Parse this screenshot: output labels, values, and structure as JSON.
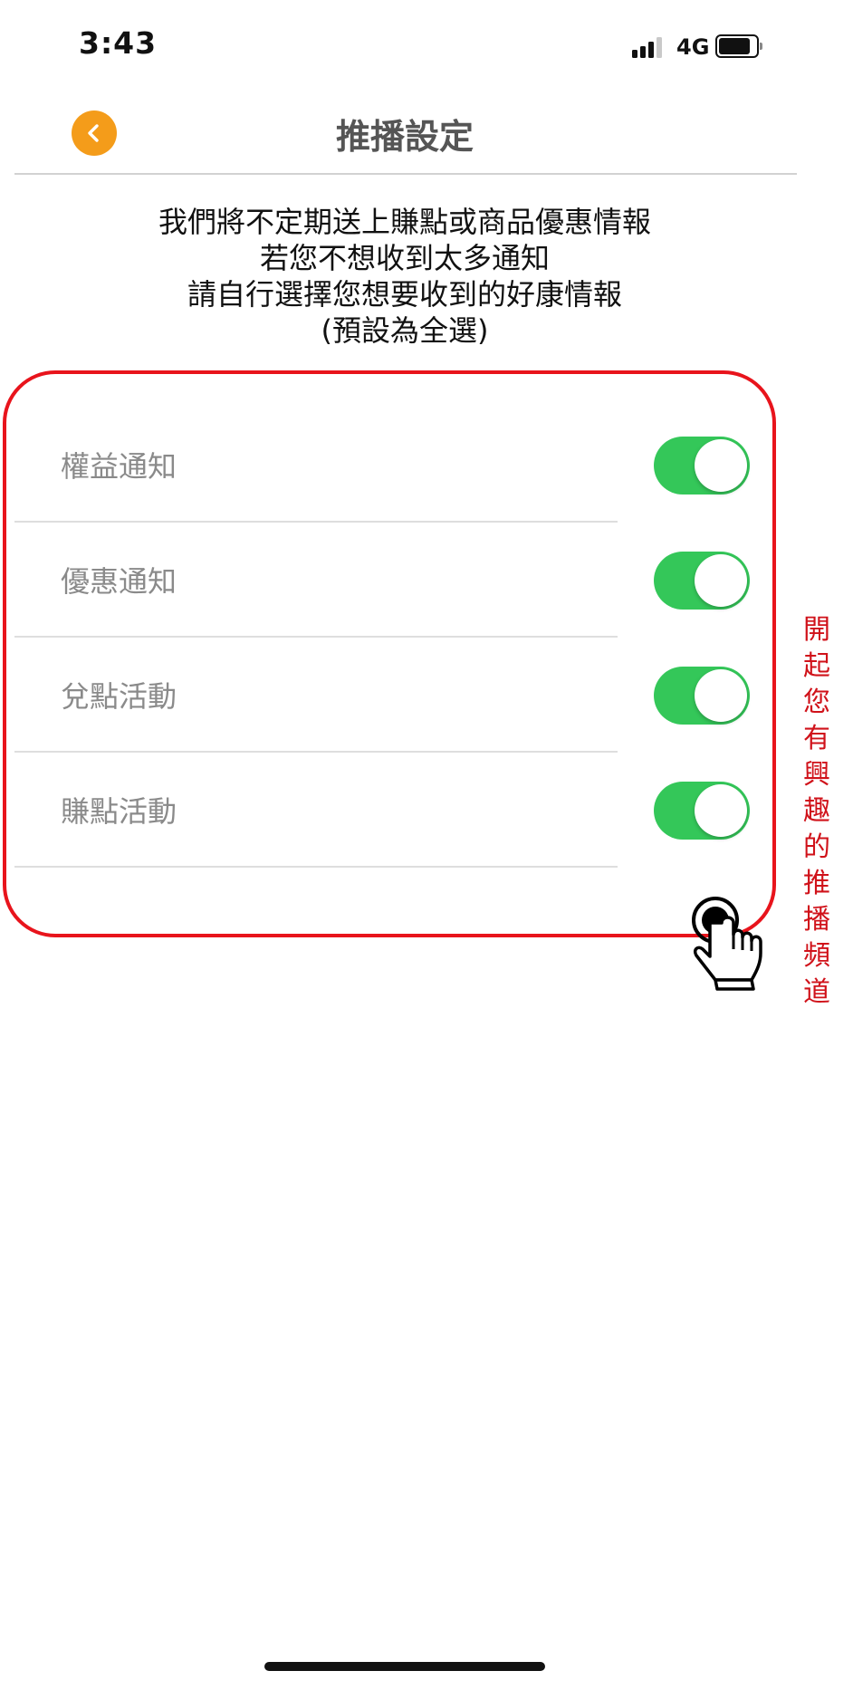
{
  "status_bar": {
    "time": "3:43",
    "network": "4G"
  },
  "header": {
    "title": "推播設定",
    "back_icon": "chevron-left-icon",
    "back_color": "#f49c1a"
  },
  "intro": {
    "lines": [
      "我們將不定期送上賺點或商品優惠情報",
      "若您不想收到太多通知",
      "請自行選擇您想要收到的好康情報",
      "(預設為全選)"
    ]
  },
  "settings": {
    "items": [
      {
        "label": "權益通知",
        "enabled": true
      },
      {
        "label": "優惠通知",
        "enabled": true
      },
      {
        "label": "兌點活動",
        "enabled": true
      },
      {
        "label": "賺點活動",
        "enabled": true
      }
    ],
    "toggle_on_color": "#34c759"
  },
  "annotation": {
    "text": "開起您有興趣的推播頻道",
    "color": "#d0121a",
    "highlight_color": "#e8141c",
    "pointer_icon": "hand-pointer-icon"
  }
}
